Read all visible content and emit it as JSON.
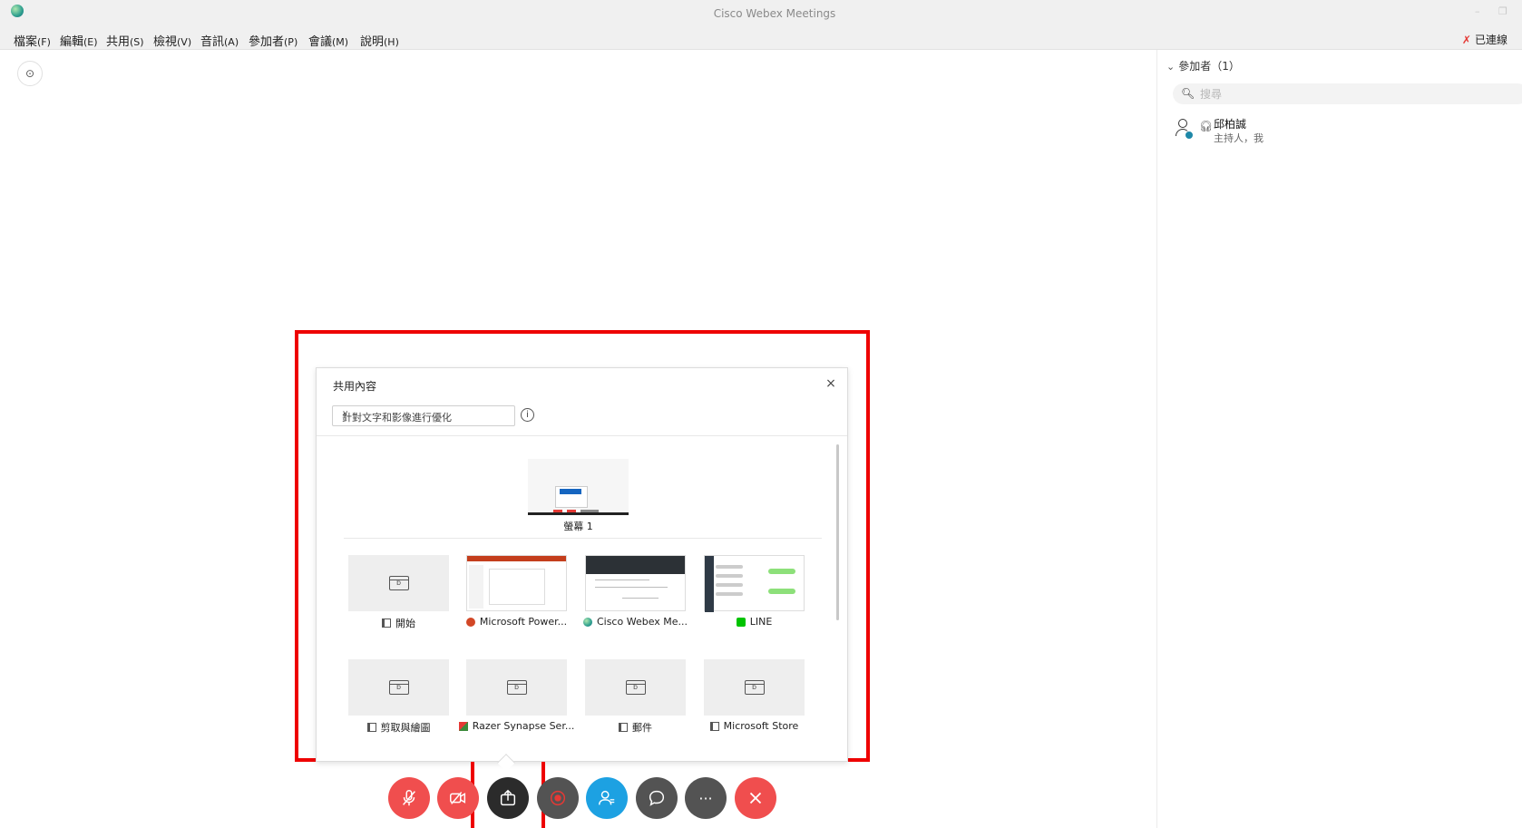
{
  "window": {
    "title": "Cisco Webex Meetings",
    "minimize": "–",
    "restore": "❐"
  },
  "menu": [
    {
      "label": "檔案",
      "acc": "(F)"
    },
    {
      "label": "編輯",
      "acc": "(E)"
    },
    {
      "label": "共用",
      "acc": "(S)"
    },
    {
      "label": "檢視",
      "acc": "(V)"
    },
    {
      "label": "音訊",
      "acc": "(A)"
    },
    {
      "label": "參加者",
      "acc": "(P)"
    },
    {
      "label": "會議",
      "acc": "(M)"
    },
    {
      "label": "說明",
      "acc": "(H)"
    }
  ],
  "status": {
    "connected": "已連線"
  },
  "stage": {
    "info": "⊙"
  },
  "panel": {
    "header": "參加者（1）",
    "search_placeholder": "搜尋",
    "participant": {
      "name": "邱柏誠",
      "role": "主持人，我"
    }
  },
  "dialog": {
    "title": "共用內容",
    "close": "×",
    "optimize": "針對文字和影像進行優化",
    "info": "i",
    "screen_label": "螢幕 1",
    "apps": [
      {
        "label": "開始",
        "icon": "window-icon"
      },
      {
        "label": "Microsoft Power...",
        "icon": "powerpoint-icon"
      },
      {
        "label": "Cisco Webex Me...",
        "icon": "webex-icon"
      },
      {
        "label": "LINE",
        "icon": "line-icon"
      },
      {
        "label": "剪取與繪圖",
        "icon": "window-icon"
      },
      {
        "label": "Razer Synapse Ser...",
        "icon": "razer-icon"
      },
      {
        "label": "郵件",
        "icon": "window-icon"
      },
      {
        "label": "Microsoft Store",
        "icon": "window-icon"
      }
    ]
  },
  "controls": {
    "colors": {
      "red": "#f04e4e",
      "dark": "#2b2b2b",
      "grey": "#535353",
      "blue": "#1da1e2",
      "end": "#f04e4e"
    },
    "more": "···"
  }
}
